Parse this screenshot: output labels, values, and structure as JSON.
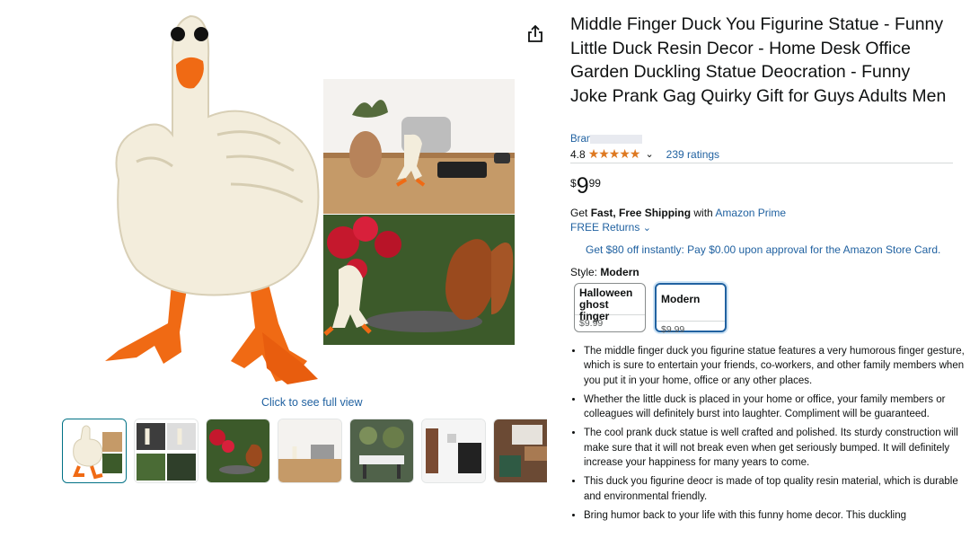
{
  "product": {
    "title": "Middle Finger Duck You Figurine Statue - Funny Little Duck Resin Decor - Home Desk Office Garden Duckling Statue Deocration - Funny Joke Prank Gag Quirky Gift for Guys Adults Men",
    "brand_label": "Bran",
    "rating_value": "4.8",
    "stars": "★★★★★",
    "ratings_count": "239 ratings",
    "price": {
      "currency": "$",
      "whole": "9",
      "fraction": "99"
    }
  },
  "gallery": {
    "click_full_view": "Click to see full view",
    "share_icon": "share-icon",
    "thumbnails": [
      "thumb-1",
      "thumb-2",
      "thumb-3",
      "thumb-4",
      "thumb-5",
      "thumb-6",
      "thumb-7"
    ]
  },
  "shipping": {
    "prefix": "Get",
    "bold": "Fast, Free Shipping",
    "with": "with",
    "prime_link": "Amazon Prime",
    "returns": "FREE Returns",
    "card_offer": "Get $80 off instantly: Pay $0.00 upon approval for the Amazon Store Card."
  },
  "style": {
    "label": "Style:",
    "selected": "Modern",
    "options": [
      {
        "name": "Halloween ghost finger",
        "price": "$9.99"
      },
      {
        "name": "Modern",
        "price": "$9.99"
      }
    ]
  },
  "bullets": [
    "The middle finger duck you figurine statue features a very humorous finger gesture, which is sure to entertain your friends, co-workers, and other family members when you put it in your home, office or any other places.",
    "Whether the little duck is placed in your home or office, your family members or colleagues will definitely burst into laughter. Compliment will be guaranteed.",
    "The cool prank duck statue is well crafted and polished. Its sturdy construction will make sure that it will not break even when get seriously bumped. It will definitely increase your happiness for many years to come.",
    "This duck you figurine deocr is made of top quality resin material, which is durable and environmental friendly.",
    "Bring humor back to your life with this funny home decor. This duckling"
  ],
  "colors": {
    "link": "#2162a1",
    "star": "#de7921",
    "orange": "#f06a14",
    "selected_border": "#2162a1"
  }
}
